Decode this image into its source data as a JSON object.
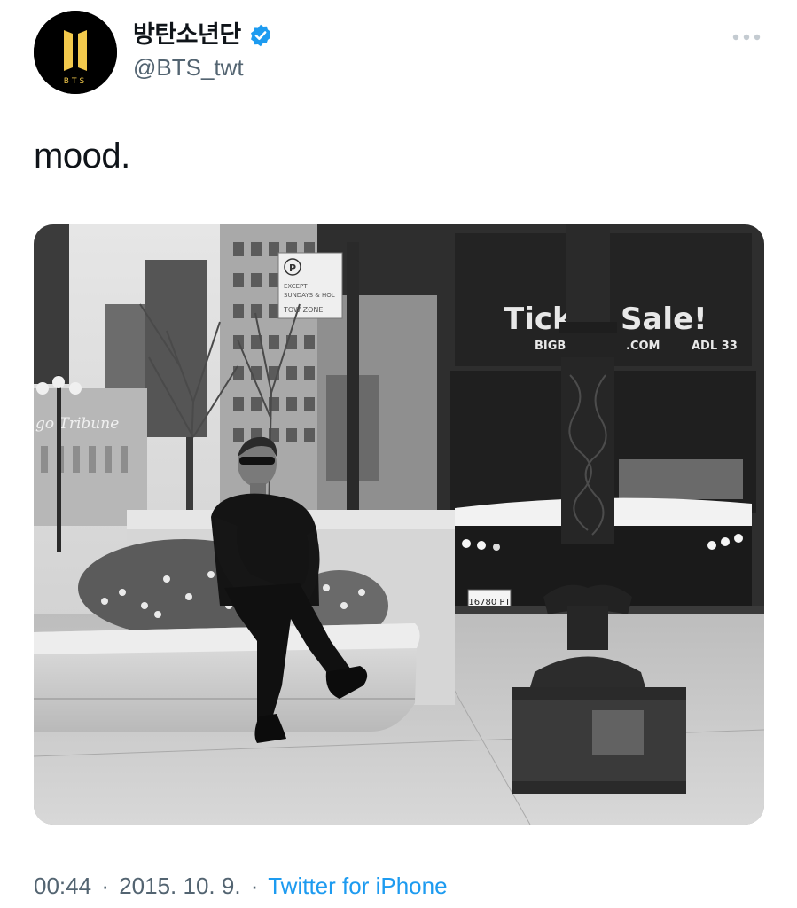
{
  "author": {
    "display_name": "방탄소년단",
    "handle": "@BTS_twt",
    "avatar_text": "BTS",
    "verified": true,
    "avatar_icon": "bts-logo-icon",
    "verified_icon": "verified-badge-icon"
  },
  "more_icon": "more-dots-icon",
  "tweet": {
    "text": "mood",
    "text_suffix": "."
  },
  "media": {
    "sign_lines": [
      "EXCEPT",
      "SUNDAYS & HOL",
      "TOW ZONE"
    ],
    "bus_sign_left": "Ticket",
    "bus_sign_right": "Sale!",
    "bus_url_left": "BIGB",
    "bus_url_right": ".COM",
    "bus_route": "ADL 33",
    "plate": "16780 PT",
    "building_sign": "go Tribune"
  },
  "meta": {
    "time": "00:44",
    "date": "2015. 10. 9.",
    "separator": "·",
    "source": "Twitter for iPhone"
  },
  "colors": {
    "source_link": "#1d9bf0",
    "verified": "#1d9bf0",
    "secondary_text": "#536471",
    "avatar_bg": "#000000",
    "avatar_logo": "#f2c94c"
  }
}
